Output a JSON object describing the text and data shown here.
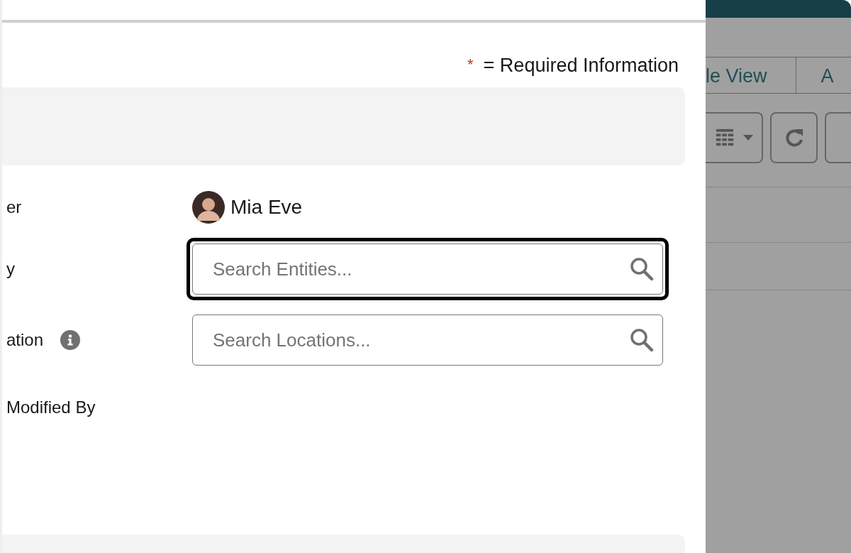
{
  "header": {
    "required_mark": "*",
    "required_text": "= Required Information"
  },
  "fields": [
    {
      "label": "er",
      "kind": "user",
      "value": "Mia Eve",
      "info": false
    },
    {
      "label": "y",
      "kind": "search",
      "placeholder": "Search Entities...",
      "focused": true,
      "info": false
    },
    {
      "label": "ation",
      "kind": "search",
      "placeholder": "Search Locations...",
      "focused": false,
      "info": true
    },
    {
      "label": "Modified By",
      "kind": "empty",
      "info": false
    }
  ],
  "background": {
    "tabs": [
      {
        "label": "le View"
      },
      {
        "label": "A"
      }
    ]
  }
}
